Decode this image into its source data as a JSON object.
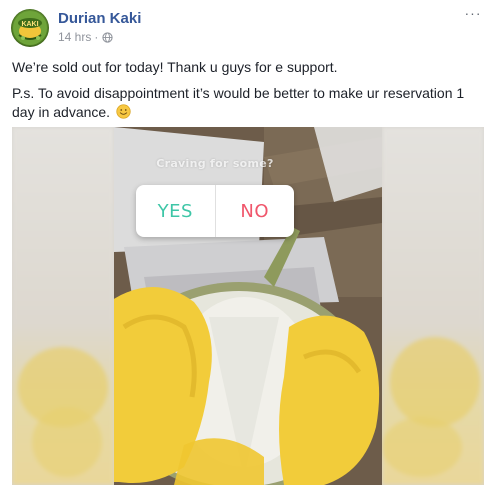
{
  "post": {
    "page_name": "Durian Kaki",
    "avatar_text": "KAKI",
    "timestamp": "14 hrs",
    "separator": "·",
    "privacy_icon": "globe-icon",
    "more_icon": "ellipsis-icon",
    "more_label": "···",
    "text_line_1": "We’re sold out for today! Thank u guys for e support.",
    "text_line_2": "P.s. To avoid disappointment it’s would be better to make ur reservation 1 day in advance.",
    "text_emoji": "smiling-face-emoji"
  },
  "media": {
    "poll_question": "Craving for some?",
    "poll_options": [
      "YES",
      "NO"
    ],
    "colors": {
      "yes": "#3ec6a7",
      "no": "#f0566b",
      "durian_flesh": "#f2cc3a",
      "link": "#365899",
      "meta": "#90949c"
    }
  }
}
